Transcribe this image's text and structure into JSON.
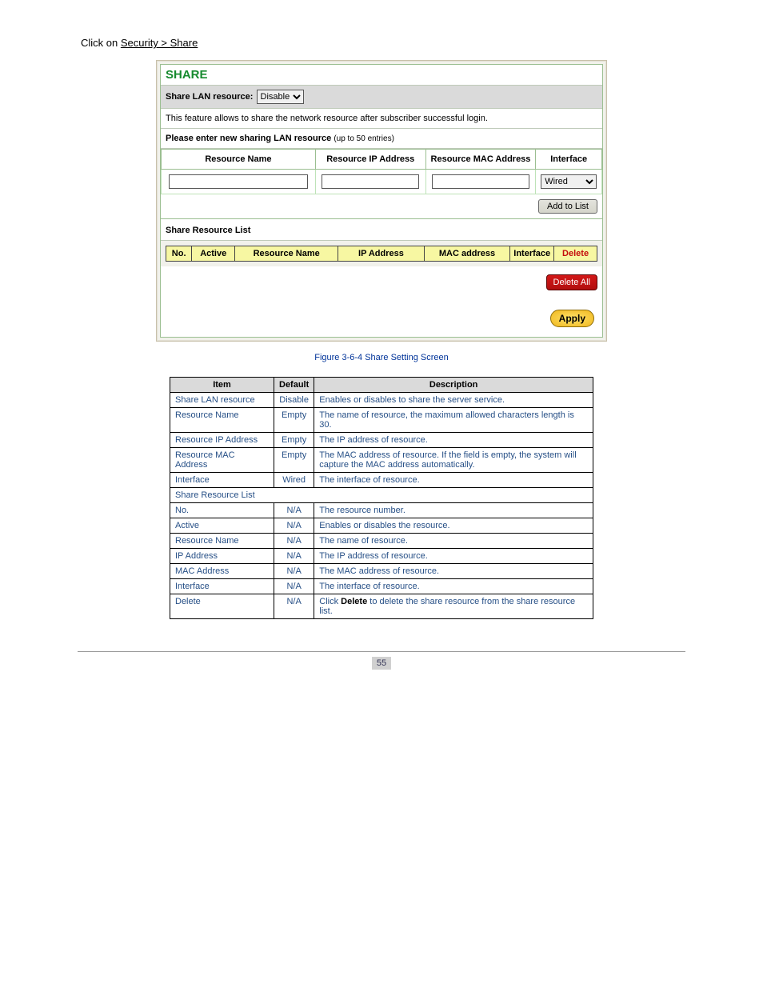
{
  "nav": {
    "path_prefix": "Click on ",
    "link": "Security > Share"
  },
  "panel": {
    "title": "SHARE",
    "share_label": "Share LAN resource:",
    "share_value": "Disable",
    "feature_text": "This feature allows to share the network resource after subscriber successful login.",
    "enter_label": "Please enter new sharing LAN resource",
    "enter_hint": "(up to 50 entries)",
    "input_headers": {
      "name": "Resource Name",
      "ip": "Resource IP Address",
      "mac": "Resource MAC Address",
      "iface": "Interface"
    },
    "iface_value": "Wired",
    "add_btn": "Add to List",
    "list_header": "Share Resource List",
    "list_cols": {
      "no": "No.",
      "active": "Active",
      "name": "Resource Name",
      "ip": "IP Address",
      "mac": "MAC address",
      "iface": "Interface",
      "del": "Delete"
    },
    "delete_all": "Delete All",
    "apply": "Apply"
  },
  "caption": "Figure 3-6-4 Share Setting Screen",
  "desc": {
    "head_item": "Item",
    "head_default": "Default",
    "head_desc": "Description",
    "rows": [
      {
        "item": "Share LAN resource",
        "def": "Disable",
        "desc": "Enables or disables to share the server service."
      },
      {
        "item": "Resource Name",
        "def": "Empty",
        "desc": "The name of resource, the maximum allowed characters length is 30."
      },
      {
        "item": "Resource IP Address",
        "def": "Empty",
        "desc": "The IP address of resource."
      },
      {
        "item": "Resource MAC Address",
        "def": "Empty",
        "desc": "The MAC address of resource. If the field is empty, the system will capture the MAC address automatically."
      },
      {
        "item": "Interface",
        "def": "Wired",
        "desc": "The interface of resource."
      }
    ],
    "band": "Share Resource List",
    "rows2": [
      {
        "item": "No.",
        "def": "N/A",
        "desc": "The resource number."
      },
      {
        "item": "Active",
        "def": "N/A",
        "desc": "Enables or disables the resource."
      },
      {
        "item": "Resource Name",
        "def": "N/A",
        "desc": "The name of resource."
      },
      {
        "item": "IP Address",
        "def": "N/A",
        "desc": "The IP address of resource."
      },
      {
        "item": "MAC Address",
        "def": "N/A",
        "desc": "The MAC address of resource."
      },
      {
        "item": "Interface",
        "def": "N/A",
        "desc": "The interface of resource."
      }
    ],
    "delete_row": {
      "item": "Delete",
      "def": "N/A",
      "desc_pre": "Click ",
      "desc_bold": "Delete",
      "desc_post": " to delete the share resource from the share resource list."
    }
  },
  "footer": {
    "page": "55"
  }
}
